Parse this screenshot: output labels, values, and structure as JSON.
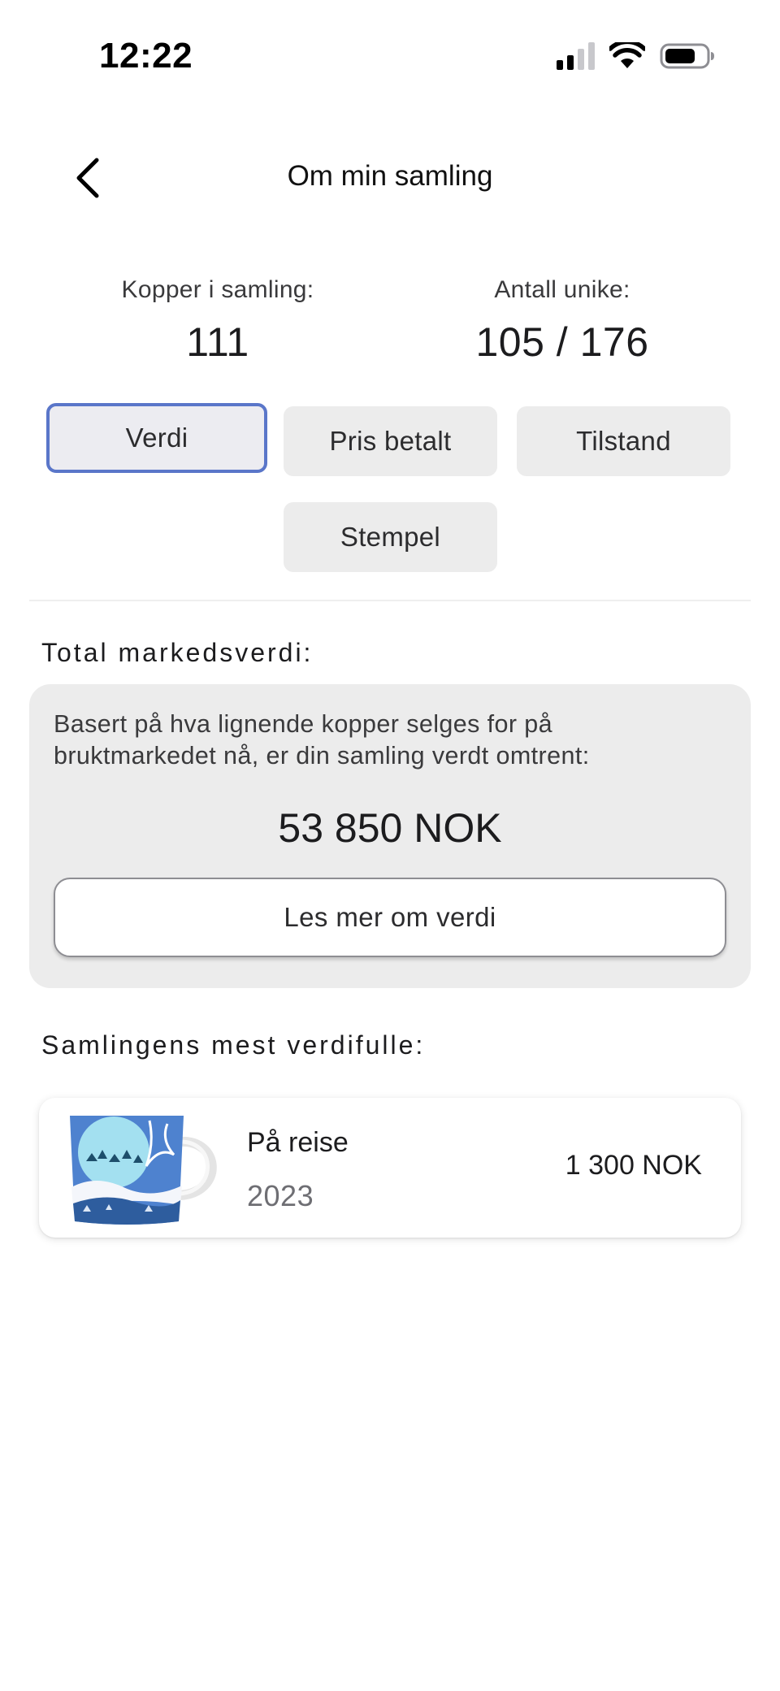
{
  "status_bar": {
    "time": "12:22"
  },
  "nav": {
    "title": "Om min samling"
  },
  "stats": {
    "cups_label": "Kopper i samling:",
    "cups_value": "111",
    "unique_label": "Antall unike:",
    "unique_value": "105 / 176"
  },
  "segments": [
    {
      "label": "Verdi",
      "selected": true
    },
    {
      "label": "Pris betalt",
      "selected": false
    },
    {
      "label": "Tilstand",
      "selected": false
    },
    {
      "label": "Stempel",
      "selected": false
    }
  ],
  "market_value": {
    "heading": "Total markedsverdi:",
    "description": "Basert på hva lignende kopper selges for på bruktmarkedet nå, er din samling verdt omtrent:",
    "total": "53 850 NOK",
    "button_label": "Les mer om verdi"
  },
  "most_valuable": {
    "heading": "Samlingens mest verdifulle:",
    "items": [
      {
        "name": "På reise",
        "year": "2023",
        "price": "1 300 NOK"
      }
    ]
  },
  "colors": {
    "accent": "#5a76c9",
    "card_bg": "#ececec"
  }
}
